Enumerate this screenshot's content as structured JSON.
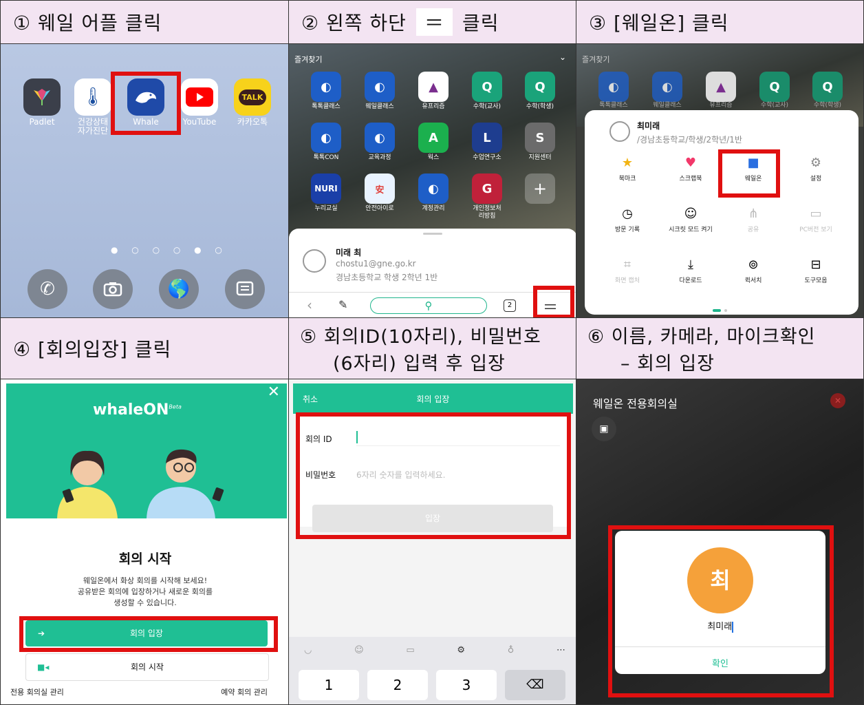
{
  "steps": [
    {
      "title": "① 웨일 어플 클릭"
    },
    {
      "title": "② 왼쪽 하단",
      "title2": "클릭",
      "key": "＝"
    },
    {
      "title": "③ [웨일온] 클릭"
    },
    {
      "title": "④ [회의입장] 클릭"
    },
    {
      "title_line1": "⑤ 회의ID(10자리), 비밀번호",
      "title_line2": "(6자리) 입력 후 입장"
    },
    {
      "title_line1": "⑥ 이름, 카메라, 마이크확인",
      "title_line2": "– 회의 입장"
    }
  ],
  "panel1": {
    "apps": [
      {
        "label": "Padlet",
        "color": "#3b3f4a",
        "icon": "padlet-icon"
      },
      {
        "label": "건강상태\n자가진단",
        "color": "#ffffff",
        "icon": "thermometer-icon"
      },
      {
        "label": "Whale",
        "color": "#1f4aa8",
        "icon": "whale-icon"
      },
      {
        "label": "YouTube",
        "color": "#ffffff",
        "icon": "youtube-icon"
      },
      {
        "label": "카카오톡",
        "color": "#f7d21b",
        "icon": "kakaotalk-icon"
      }
    ],
    "talk": "TALK",
    "dock": [
      "phone-icon",
      "camera-icon",
      "globe-icon",
      "message-icon"
    ]
  },
  "panel2": {
    "favorites": "즐겨찾기",
    "row1": [
      "톡톡클래스",
      "웨일클래스",
      "유프리즘",
      "수학(교사)",
      "수학(학생)"
    ],
    "row2": [
      "톡톡CON",
      "교육과정",
      "웍스",
      "수업연구소",
      "지원센터"
    ],
    "row3": [
      "누리교실",
      "안전아이로",
      "계정관리",
      "개인정보처\n리방침",
      ""
    ],
    "tile_letters": {
      "r1c4": "Q",
      "r1c5": "Q",
      "r2c3": "A",
      "r2c4": "L",
      "r2c5": "S",
      "r3c1": "NURI",
      "r3c4": "G",
      "r3c5": "+"
    },
    "user_name": "미래 최",
    "email": "chostu1@gne.go.kr",
    "school": "경남초등학교 학생 2학년 1반",
    "tab_count": "2"
  },
  "panel3": {
    "favorites": "즐겨찾기",
    "row1": [
      "톡톡클래스",
      "웨일클래스",
      "유프리즘",
      "수학(교사)",
      "수학(학생)"
    ],
    "user_name": "최미래",
    "user_info": "/경남초등학교/학생/2학년/1반",
    "menu": [
      {
        "icon": "star-icon",
        "label": "북마크"
      },
      {
        "icon": "heart-icon",
        "label": "스크랩북"
      },
      {
        "icon": "video-icon",
        "label": "웨일온"
      },
      {
        "icon": "gear-icon",
        "label": "설정"
      },
      {
        "icon": "clock-icon",
        "label": "방문 기록"
      },
      {
        "icon": "secret-icon",
        "label": "시크릿 모드 켜기"
      },
      {
        "icon": "share-icon",
        "label": "공유"
      },
      {
        "icon": "monitor-icon",
        "label": "PC버전 보기"
      },
      {
        "icon": "capture-icon",
        "label": "화면 캡처"
      },
      {
        "icon": "download-icon",
        "label": "다운로드"
      },
      {
        "icon": "quicksearch-icon",
        "label": "퀵서치"
      },
      {
        "icon": "toolbox-icon",
        "label": "도구모음"
      }
    ]
  },
  "panel4": {
    "logo": "whaleON",
    "beta": "Beta",
    "heading": "회의 시작",
    "desc1": "웨일온에서 화상 회의를 시작해 보세요!",
    "desc2": "공유받은 회의에 입장하거나 새로운 회의를",
    "desc3": "생성할 수 있습니다.",
    "join": "회의 입장",
    "start": "회의 시작",
    "manage_room": "전용 회의실 관리",
    "manage_reserve": "예약 회의 관리"
  },
  "panel5": {
    "cancel": "취소",
    "title": "회의 입장",
    "id_label": "회의 ID",
    "pw_label": "비밀번호",
    "pw_placeholder": "6자리 숫자를 입력하세요.",
    "enter": "입장",
    "keys": [
      "1",
      "2",
      "3"
    ]
  },
  "panel6": {
    "title": "웨일온 전용회의실",
    "avatar": "최",
    "name": "최미래",
    "confirm": "확인"
  }
}
